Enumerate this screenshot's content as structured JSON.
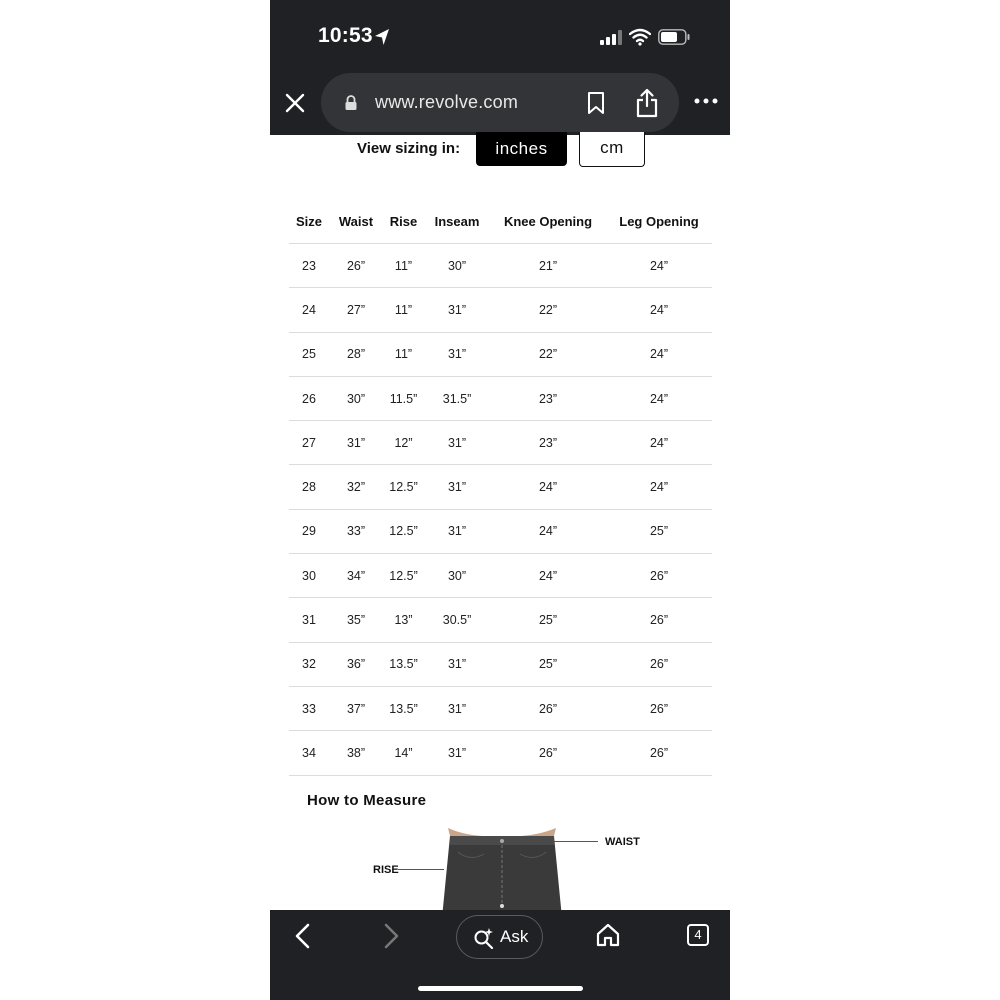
{
  "status_bar": {
    "time": "10:53"
  },
  "browser": {
    "url": "www.revolve.com",
    "tab_count": "4",
    "ask_label": "Ask"
  },
  "sizing": {
    "label": "View sizing in:",
    "options": [
      "inches",
      "cm"
    ],
    "selected": "inches"
  },
  "size_table": {
    "headers": [
      "Size",
      "Waist",
      "Rise",
      "Inseam",
      "Knee Opening",
      "Leg Opening"
    ],
    "rows": [
      [
        "23",
        "26”",
        "11”",
        "30”",
        "21”",
        "24”"
      ],
      [
        "24",
        "27”",
        "11”",
        "31”",
        "22”",
        "24”"
      ],
      [
        "25",
        "28”",
        "11”",
        "31”",
        "22”",
        "24”"
      ],
      [
        "26",
        "30”",
        "11.5”",
        "31.5”",
        "23”",
        "24”"
      ],
      [
        "27",
        "31”",
        "12”",
        "31”",
        "23”",
        "24”"
      ],
      [
        "28",
        "32”",
        "12.5”",
        "31”",
        "24”",
        "24”"
      ],
      [
        "29",
        "33”",
        "12.5”",
        "31”",
        "24”",
        "25”"
      ],
      [
        "30",
        "34”",
        "12.5”",
        "30”",
        "24”",
        "26”"
      ],
      [
        "31",
        "35”",
        "13”",
        "30.5”",
        "25”",
        "26”"
      ],
      [
        "32",
        "36”",
        "13.5”",
        "31”",
        "25”",
        "26”"
      ],
      [
        "33",
        "37”",
        "13.5”",
        "31”",
        "26”",
        "26”"
      ],
      [
        "34",
        "38”",
        "14”",
        "31”",
        "26”",
        "26”"
      ]
    ]
  },
  "how_to_measure": {
    "title": "How to Measure",
    "labels": {
      "waist": "WAIST",
      "rise": "RISE"
    }
  },
  "icons": {
    "status": [
      "location-arrow-icon",
      "signal-icon",
      "wifi-icon",
      "battery-icon"
    ],
    "browser": [
      "close-icon",
      "lock-icon",
      "bookmark-icon",
      "share-icon",
      "more-icon"
    ],
    "toolbar": [
      "back-icon",
      "forward-icon",
      "ask-search-icon",
      "home-icon",
      "tabs-icon"
    ]
  },
  "colors": {
    "chrome": "#202124",
    "urlbar": "#333437",
    "selected_toggle": "#000000"
  }
}
